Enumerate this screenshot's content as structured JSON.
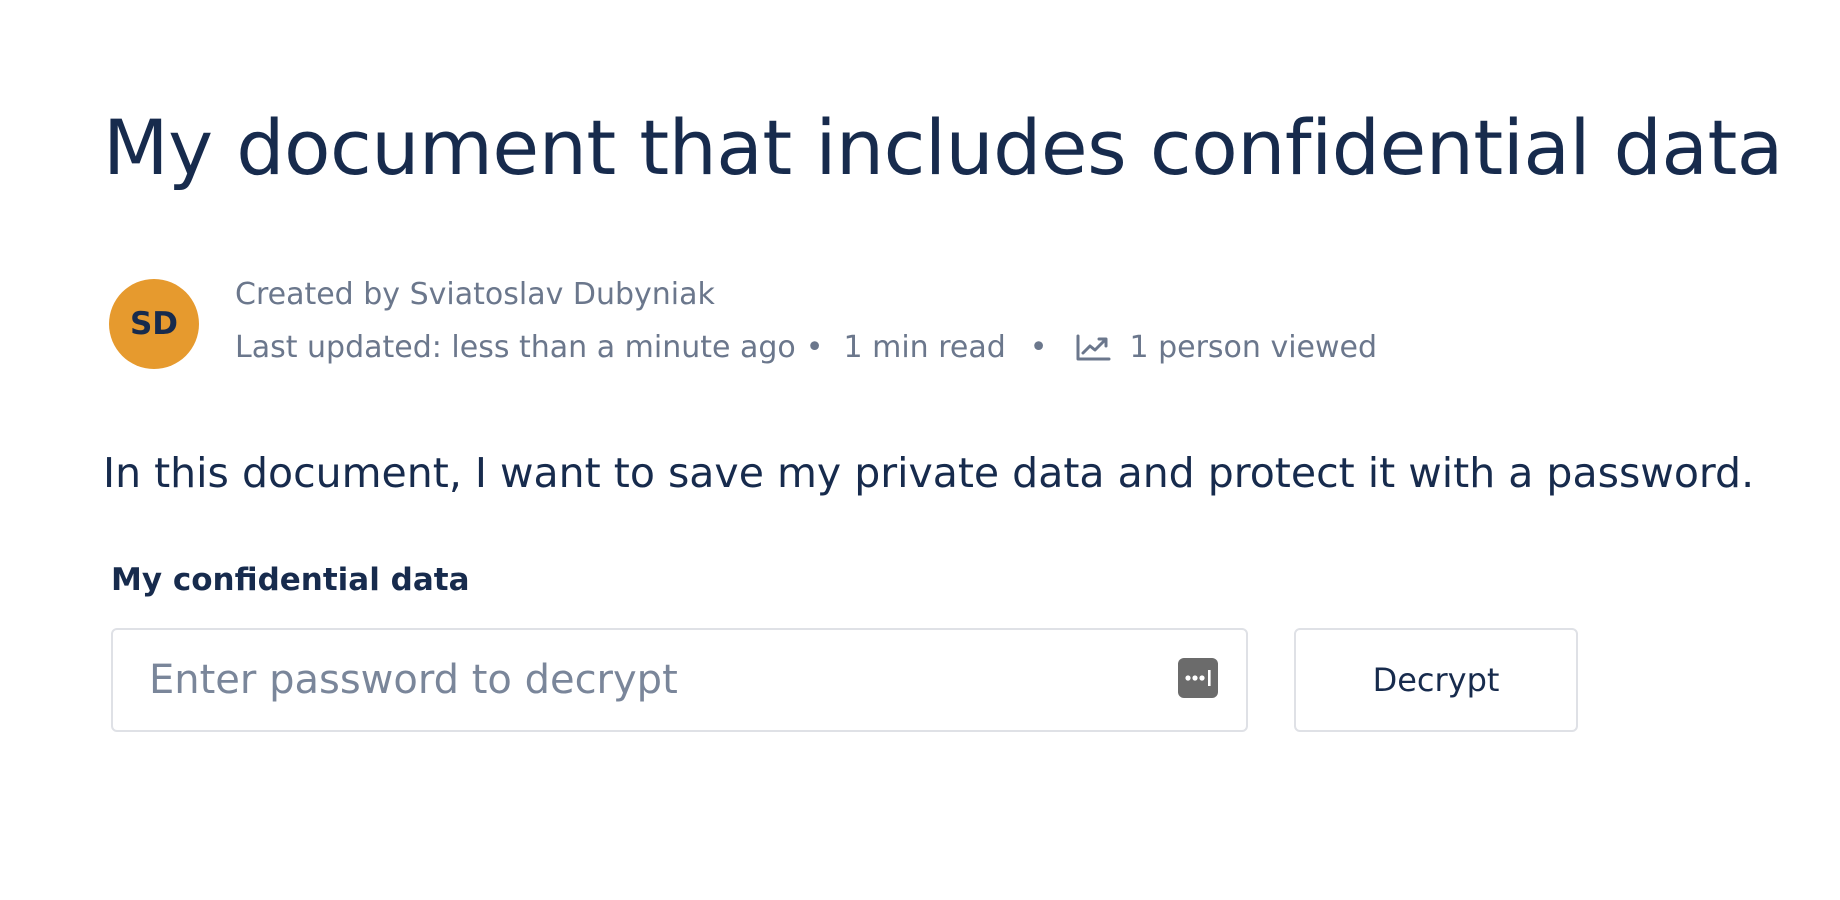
{
  "page": {
    "title": "My document that includes confidential data"
  },
  "byline": {
    "avatar_initials": "SD",
    "avatar_color": "#e69a2e",
    "created_by": "Created by Sviatoslav Dubyniak",
    "last_updated": "Last updated: less than a minute ago",
    "separator": "•",
    "read_time": "1 min read",
    "views_icon": "trend-up-icon",
    "views": "1 person viewed"
  },
  "content": {
    "paragraph": "In this document, I want to save my private data and protect it with a password."
  },
  "protected_field": {
    "label": "My confidential data",
    "password_value": "",
    "password_placeholder": "Enter password to decrypt",
    "key_icon": "password-manager-icon",
    "decrypt_label": "Decrypt"
  },
  "colors": {
    "text_primary": "#172b4d",
    "text_secondary": "#6b778c",
    "border": "#dfe1e6"
  }
}
